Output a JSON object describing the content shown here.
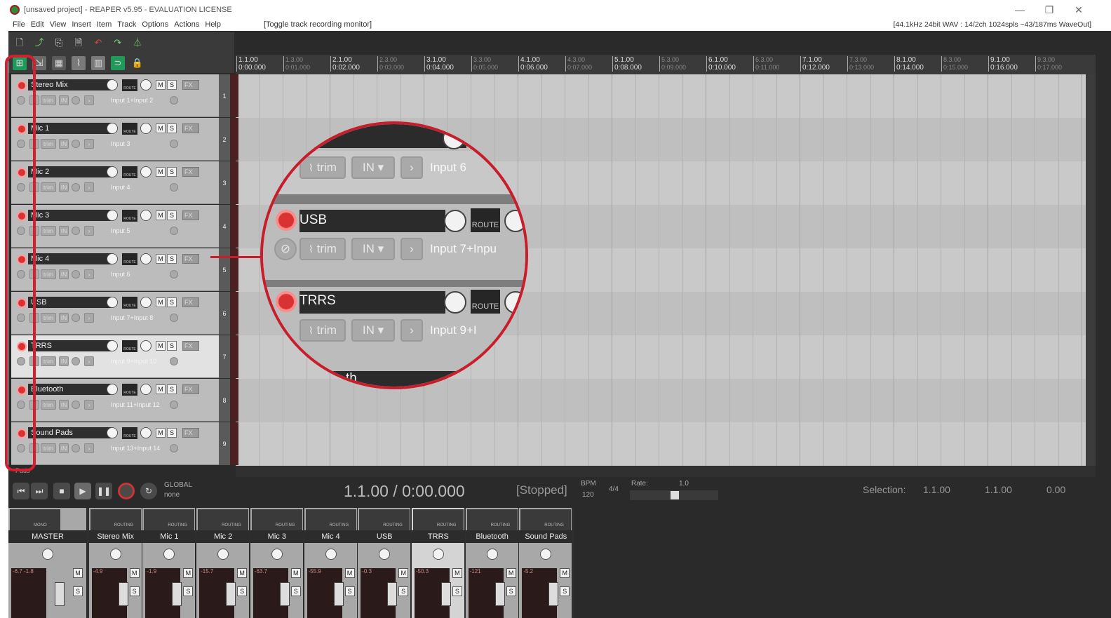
{
  "window": {
    "title": "[unsaved project] - REAPER v5.95 - EVALUATION LICENSE",
    "minimize": "—",
    "restore": "❐",
    "close": "✕"
  },
  "menu": {
    "items": [
      "File",
      "Edit",
      "View",
      "Insert",
      "Item",
      "Track",
      "Options",
      "Actions",
      "Help"
    ],
    "action": "[Toggle track recording monitor]",
    "status": "[44.1kHz 24bit WAV : 14/2ch 1024spls ~43/187ms WaveOut]"
  },
  "ruler": {
    "major": [
      {
        "bar": "1.1.00",
        "time": "0:00.000"
      },
      {
        "bar": "2.1.00",
        "time": "0:02.000"
      },
      {
        "bar": "3.1.00",
        "time": "0:04.000"
      },
      {
        "bar": "4.1.00",
        "time": "0:06.000"
      },
      {
        "bar": "5.1.00",
        "time": "0:08.000"
      },
      {
        "bar": "6.1.00",
        "time": "0:10.000"
      },
      {
        "bar": "7.1.00",
        "time": "0:12.000"
      },
      {
        "bar": "8.1.00",
        "time": "0:14.000"
      },
      {
        "bar": "9.1.00",
        "time": "0:16.000"
      }
    ],
    "minor": [
      {
        "bar": "1.3.00",
        "time": "0:01.000"
      },
      {
        "bar": "2.3.00",
        "time": "0:03.000"
      },
      {
        "bar": "3.3.00",
        "time": "0:05.000"
      },
      {
        "bar": "4.3.00",
        "time": "0:07.000"
      },
      {
        "bar": "5.3.00",
        "time": "0:09.000"
      },
      {
        "bar": "6.3.00",
        "time": "0:11.000"
      },
      {
        "bar": "7.3.00",
        "time": "0:13.000"
      },
      {
        "bar": "8.3.00",
        "time": "0:15.000"
      },
      {
        "bar": "9.3.00",
        "time": "0:17.000"
      }
    ]
  },
  "labels": {
    "trim": "trim",
    "in": "IN",
    "route": "ROUTE",
    "m": "M",
    "s": "S",
    "fx": "FX",
    "below_tracks": "Pads"
  },
  "tracks": [
    {
      "num": "1",
      "name": "Stereo Mix",
      "input": "Input 1+Input 2"
    },
    {
      "num": "2",
      "name": "Mic 1",
      "input": "Input 3"
    },
    {
      "num": "3",
      "name": "Mic 2",
      "input": "Input 4"
    },
    {
      "num": "4",
      "name": "Mic 3",
      "input": "Input 5"
    },
    {
      "num": "5",
      "name": "Mic 4",
      "input": "Input 6"
    },
    {
      "num": "6",
      "name": "USB",
      "input": "Input 7+Input 8"
    },
    {
      "num": "7",
      "name": "TRRS",
      "input": "Input 9+Input 10"
    },
    {
      "num": "8",
      "name": "Bluetooth",
      "input": "Input 11+Input 12"
    },
    {
      "num": "9",
      "name": "Sound Pads",
      "input": "Input 13+Input 14"
    }
  ],
  "zoom": {
    "usb_name": "USB",
    "usb_input": "Input 7+Inpu",
    "trrs_name": "TRRS",
    "trrs_input": "Input 9+I",
    "top_input": "Input 6",
    "bottom_name": "th"
  },
  "transport": {
    "time": "1.1.00 / 0:00.000",
    "state": "[Stopped]",
    "bpm_label": "BPM",
    "bpm": "120",
    "sig": "4/4",
    "rate_label": "Rate:",
    "rate": "1.0",
    "global": "GLOBAL",
    "none": "none",
    "selection_label": "Selection:",
    "sel_start": "1.1.00",
    "sel_end": "1.1.00",
    "sel_len": "0.00"
  },
  "mixer": [
    {
      "name": "MASTER",
      "peak": "-6.7   -1.8",
      "sub": "MONO"
    },
    {
      "name": "Stereo Mix",
      "peak": "-4.9",
      "sub": "ROUTING"
    },
    {
      "name": "Mic 1",
      "peak": "-1.9",
      "sub": "ROUTING"
    },
    {
      "name": "Mic 2",
      "peak": "-15.7",
      "sub": "ROUTING"
    },
    {
      "name": "Mic 3",
      "peak": "-63.7",
      "sub": "ROUTING"
    },
    {
      "name": "Mic 4",
      "peak": "-55.9",
      "sub": "ROUTING"
    },
    {
      "name": "USB",
      "peak": "-0.3",
      "sub": "ROUTING"
    },
    {
      "name": "TRRS",
      "peak": "-50.3",
      "sub": "ROUTING"
    },
    {
      "name": "Bluetooth",
      "peak": "-121",
      "sub": "ROUTING"
    },
    {
      "name": "Sound Pads",
      "peak": "-5.2",
      "sub": "ROUTING"
    }
  ],
  "colors": {
    "accent_red": "#c81e2b",
    "rec_arm": "#d93232",
    "panel": "#bcbcbc",
    "arrange_bg": "#c6c6c6"
  }
}
